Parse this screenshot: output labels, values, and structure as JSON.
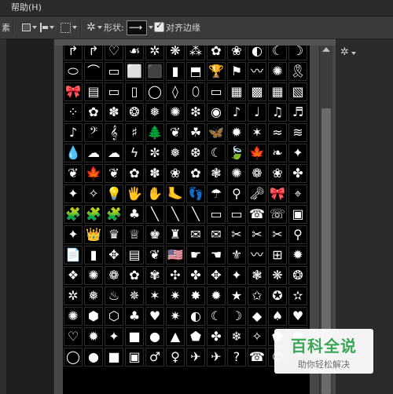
{
  "menubar": {
    "help": "帮助(H)"
  },
  "optionsbar": {
    "left_fragment": "素",
    "shape_label": "形状:",
    "align_edges_label": "对齐边缘",
    "align_edges_checked": true,
    "shape_swatch_glyph": "⟶"
  },
  "panel": {
    "shapes": [
      "↱",
      "↱",
      "♡",
      "☙",
      "✲",
      "❋",
      "⁂",
      "✿",
      "❀",
      "◐",
      "☾",
      "☽",
      "⬭",
      "⌒",
      "▭",
      "⬜",
      "⬛",
      "▮",
      "⬒",
      "🏆",
      "⚑",
      "〰",
      "✺",
      "🎗",
      "🎀",
      "▤",
      "▭",
      "▯",
      "◯",
      "◊",
      "⬯",
      "▭",
      "▦",
      "▩",
      "▦",
      "▧",
      "⁘",
      "✿",
      "✽",
      "❂",
      "❅",
      "✺",
      "❇",
      "◉",
      "♪",
      "♩",
      "♫",
      "♬",
      "♪",
      "𝄢",
      "𝄞",
      "♯",
      "🌲",
      "❦",
      "☘",
      "🦋",
      "✹",
      "✶",
      "≈",
      "≋",
      "💧",
      "☁",
      "☁",
      "ϟ",
      "✼",
      "❅",
      "❆",
      "☾",
      "🍃",
      "🍁",
      "❧",
      "✦",
      "❦",
      "🍁",
      "❦",
      "✿",
      "✽",
      "❀",
      "✿",
      "❃",
      "✺",
      "❁",
      "❀",
      "✤",
      "✦",
      "✧",
      "💡",
      "🖐",
      "✋",
      "🦶",
      "👣",
      "☂",
      "⚲",
      "🗝",
      "🎀",
      "⌖",
      "🧩",
      "🧩",
      "🧩",
      "♣",
      "╲",
      "╲",
      "╲",
      "▭",
      "▭",
      "☎",
      "☏",
      "▣",
      "✦",
      "👑",
      "♛",
      "♕",
      "♚",
      "♜",
      "✉",
      "✉",
      "✂",
      "✂",
      "✂",
      "⚲",
      "📄",
      "▮",
      "✥",
      "▤",
      "❦",
      "🇺🇸",
      "☛",
      "☚",
      "⚜",
      "〰",
      "⊞",
      "✹",
      "❖",
      "✺",
      "❁",
      "✿",
      "✾",
      "✣",
      "✤",
      "✥",
      "✦",
      "❃",
      "❋",
      "❂",
      "✲",
      "❅",
      "♨",
      "✵",
      "✶",
      "✷",
      "✸",
      "✹",
      "★",
      "✩",
      "✪",
      "✫",
      "✺",
      "⬢",
      "⬡",
      "♣",
      "♥",
      "✷",
      "◐",
      "☾",
      "☽",
      "◆",
      "♠",
      "♥",
      "♡",
      "✹",
      "✦",
      "■",
      "●",
      "▲",
      "⬟",
      "✤",
      "❄",
      "✧",
      "⬟",
      "⬢",
      "◯",
      "●",
      "■",
      "▣",
      "♂",
      "♀",
      "✈",
      "✈",
      "?",
      "☎",
      "©",
      "™"
    ]
  },
  "scrollbar": {
    "up_glyph": "▲"
  },
  "right_panel": {
    "gear_glyph": "✲"
  },
  "watermark": {
    "title": "百科全说",
    "subtitle": "助你轻松解决"
  }
}
